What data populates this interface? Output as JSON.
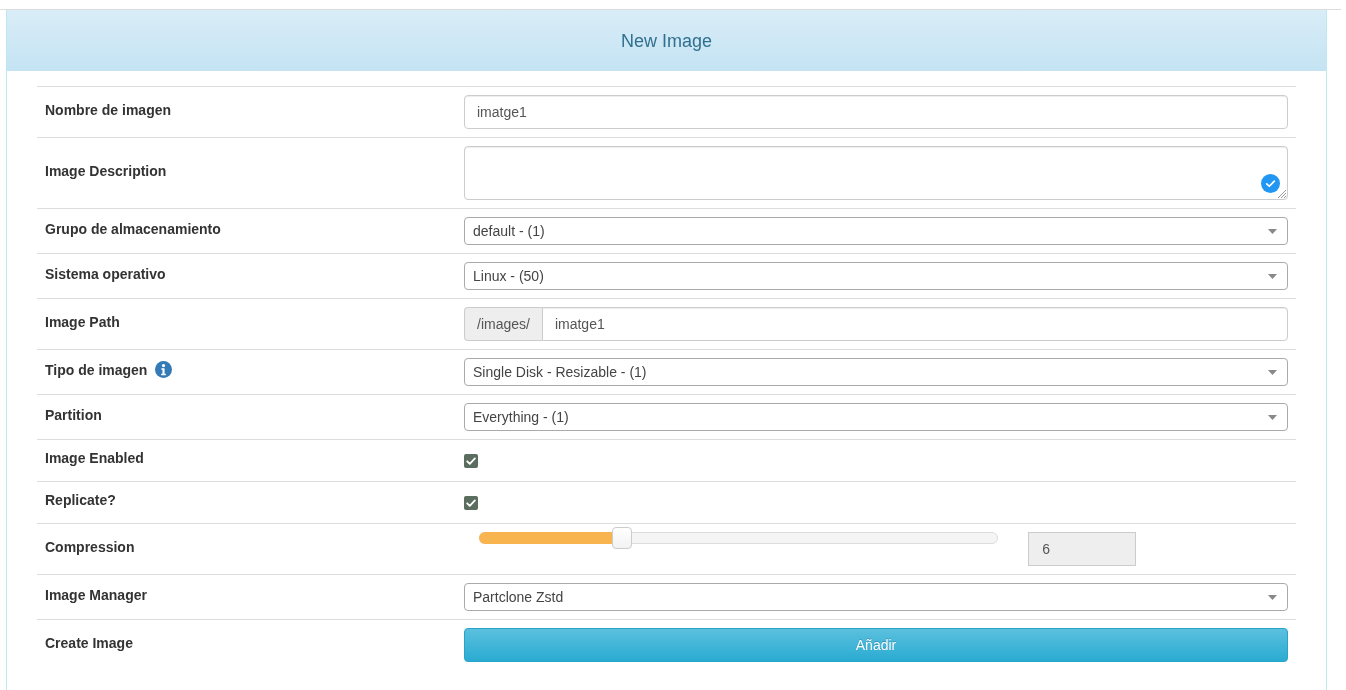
{
  "panel": {
    "title": "New Image"
  },
  "form": {
    "rows": [
      {
        "label": "Nombre de imagen",
        "kind": "text",
        "value": "imatge1"
      },
      {
        "label": "Image Description",
        "kind": "textarea"
      },
      {
        "label": "Grupo de almacenamiento",
        "kind": "select",
        "value": "default - (1)"
      },
      {
        "label": "Sistema operativo",
        "kind": "select",
        "value": "Linux - (50)"
      },
      {
        "label": "Image Path",
        "kind": "prefixed",
        "prefix": "/images/",
        "value": "imatge1"
      },
      {
        "label": "Tipo de imagen",
        "kind": "select",
        "info_icon": true,
        "value": "Single Disk - Resizable - (1)"
      },
      {
        "label": "Partition",
        "kind": "select",
        "value": "Everything - (1)"
      },
      {
        "label": "Image Enabled",
        "kind": "checkbox",
        "checked": true
      },
      {
        "label": "Replicate?",
        "kind": "checkbox",
        "checked": true
      },
      {
        "label": "Compression",
        "kind": "slider",
        "level": 0.275,
        "reading": "6"
      },
      {
        "label": "Image Manager",
        "kind": "select",
        "value": "Partclone Zstd"
      },
      {
        "label": "Create Image",
        "kind": "button",
        "button": "Añadir"
      }
    ]
  }
}
